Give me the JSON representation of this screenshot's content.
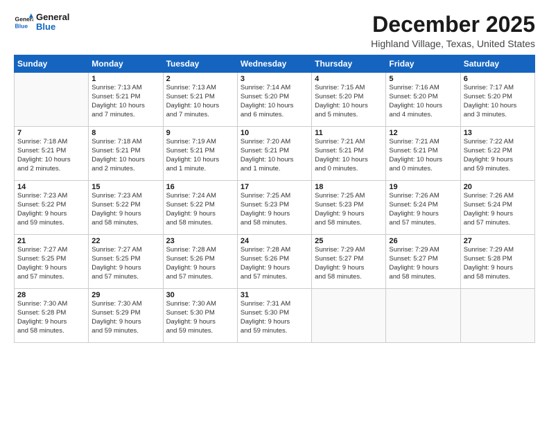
{
  "header": {
    "logo_general": "General",
    "logo_blue": "Blue",
    "month_title": "December 2025",
    "location": "Highland Village, Texas, United States"
  },
  "days_of_week": [
    "Sunday",
    "Monday",
    "Tuesday",
    "Wednesday",
    "Thursday",
    "Friday",
    "Saturday"
  ],
  "weeks": [
    [
      {
        "day": "",
        "info": ""
      },
      {
        "day": "1",
        "info": "Sunrise: 7:13 AM\nSunset: 5:21 PM\nDaylight: 10 hours\nand 7 minutes."
      },
      {
        "day": "2",
        "info": "Sunrise: 7:13 AM\nSunset: 5:21 PM\nDaylight: 10 hours\nand 7 minutes."
      },
      {
        "day": "3",
        "info": "Sunrise: 7:14 AM\nSunset: 5:20 PM\nDaylight: 10 hours\nand 6 minutes."
      },
      {
        "day": "4",
        "info": "Sunrise: 7:15 AM\nSunset: 5:20 PM\nDaylight: 10 hours\nand 5 minutes."
      },
      {
        "day": "5",
        "info": "Sunrise: 7:16 AM\nSunset: 5:20 PM\nDaylight: 10 hours\nand 4 minutes."
      },
      {
        "day": "6",
        "info": "Sunrise: 7:17 AM\nSunset: 5:20 PM\nDaylight: 10 hours\nand 3 minutes."
      }
    ],
    [
      {
        "day": "7",
        "info": "Sunrise: 7:18 AM\nSunset: 5:21 PM\nDaylight: 10 hours\nand 2 minutes."
      },
      {
        "day": "8",
        "info": "Sunrise: 7:18 AM\nSunset: 5:21 PM\nDaylight: 10 hours\nand 2 minutes."
      },
      {
        "day": "9",
        "info": "Sunrise: 7:19 AM\nSunset: 5:21 PM\nDaylight: 10 hours\nand 1 minute."
      },
      {
        "day": "10",
        "info": "Sunrise: 7:20 AM\nSunset: 5:21 PM\nDaylight: 10 hours\nand 1 minute."
      },
      {
        "day": "11",
        "info": "Sunrise: 7:21 AM\nSunset: 5:21 PM\nDaylight: 10 hours\nand 0 minutes."
      },
      {
        "day": "12",
        "info": "Sunrise: 7:21 AM\nSunset: 5:21 PM\nDaylight: 10 hours\nand 0 minutes."
      },
      {
        "day": "13",
        "info": "Sunrise: 7:22 AM\nSunset: 5:22 PM\nDaylight: 9 hours\nand 59 minutes."
      }
    ],
    [
      {
        "day": "14",
        "info": "Sunrise: 7:23 AM\nSunset: 5:22 PM\nDaylight: 9 hours\nand 59 minutes."
      },
      {
        "day": "15",
        "info": "Sunrise: 7:23 AM\nSunset: 5:22 PM\nDaylight: 9 hours\nand 58 minutes."
      },
      {
        "day": "16",
        "info": "Sunrise: 7:24 AM\nSunset: 5:22 PM\nDaylight: 9 hours\nand 58 minutes."
      },
      {
        "day": "17",
        "info": "Sunrise: 7:25 AM\nSunset: 5:23 PM\nDaylight: 9 hours\nand 58 minutes."
      },
      {
        "day": "18",
        "info": "Sunrise: 7:25 AM\nSunset: 5:23 PM\nDaylight: 9 hours\nand 58 minutes."
      },
      {
        "day": "19",
        "info": "Sunrise: 7:26 AM\nSunset: 5:24 PM\nDaylight: 9 hours\nand 57 minutes."
      },
      {
        "day": "20",
        "info": "Sunrise: 7:26 AM\nSunset: 5:24 PM\nDaylight: 9 hours\nand 57 minutes."
      }
    ],
    [
      {
        "day": "21",
        "info": "Sunrise: 7:27 AM\nSunset: 5:25 PM\nDaylight: 9 hours\nand 57 minutes."
      },
      {
        "day": "22",
        "info": "Sunrise: 7:27 AM\nSunset: 5:25 PM\nDaylight: 9 hours\nand 57 minutes."
      },
      {
        "day": "23",
        "info": "Sunrise: 7:28 AM\nSunset: 5:26 PM\nDaylight: 9 hours\nand 57 minutes."
      },
      {
        "day": "24",
        "info": "Sunrise: 7:28 AM\nSunset: 5:26 PM\nDaylight: 9 hours\nand 57 minutes."
      },
      {
        "day": "25",
        "info": "Sunrise: 7:29 AM\nSunset: 5:27 PM\nDaylight: 9 hours\nand 58 minutes."
      },
      {
        "day": "26",
        "info": "Sunrise: 7:29 AM\nSunset: 5:27 PM\nDaylight: 9 hours\nand 58 minutes."
      },
      {
        "day": "27",
        "info": "Sunrise: 7:29 AM\nSunset: 5:28 PM\nDaylight: 9 hours\nand 58 minutes."
      }
    ],
    [
      {
        "day": "28",
        "info": "Sunrise: 7:30 AM\nSunset: 5:28 PM\nDaylight: 9 hours\nand 58 minutes."
      },
      {
        "day": "29",
        "info": "Sunrise: 7:30 AM\nSunset: 5:29 PM\nDaylight: 9 hours\nand 59 minutes."
      },
      {
        "day": "30",
        "info": "Sunrise: 7:30 AM\nSunset: 5:30 PM\nDaylight: 9 hours\nand 59 minutes."
      },
      {
        "day": "31",
        "info": "Sunrise: 7:31 AM\nSunset: 5:30 PM\nDaylight: 9 hours\nand 59 minutes."
      },
      {
        "day": "",
        "info": ""
      },
      {
        "day": "",
        "info": ""
      },
      {
        "day": "",
        "info": ""
      }
    ]
  ]
}
